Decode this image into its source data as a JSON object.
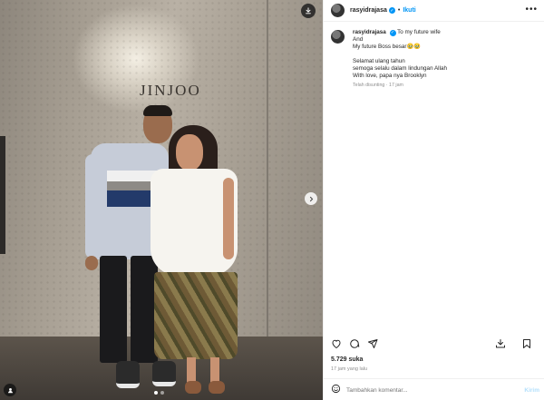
{
  "photo": {
    "sign_text": "JINJOO",
    "download_icon": "download-icon",
    "next_icon": "chevron-right-icon",
    "tag_icon": "user-tag-icon",
    "carousel_count": 2
  },
  "header": {
    "username": "rasyidrajasa",
    "separator": "•",
    "follow_label": "Ikuti",
    "more_label": "•••"
  },
  "caption": {
    "username": "rasyidrajasa",
    "lines": [
      "To my future wife",
      "And",
      "My future Boss besar🥹🥹",
      "",
      "Selamat ulang tahun",
      "semoga selalu dalam lindungan Allah",
      "With love, papa nya Brooklyn"
    ],
    "meta": "Telah disunting · 17 jam"
  },
  "actions": {
    "like_icon": "heart-icon",
    "comment_icon": "comment-icon",
    "share_icon": "share-icon",
    "save_icon": "bookmark-icon",
    "repost_icon": "download-icon"
  },
  "likes": "5.729 suka",
  "time_ago": "17 jam yang lalu",
  "comment": {
    "placeholder": "Tambahkan komentar...",
    "post_label": "Kirim"
  },
  "colors": {
    "accent": "#0095f6",
    "text": "#262626",
    "muted": "#8e8e8e"
  }
}
